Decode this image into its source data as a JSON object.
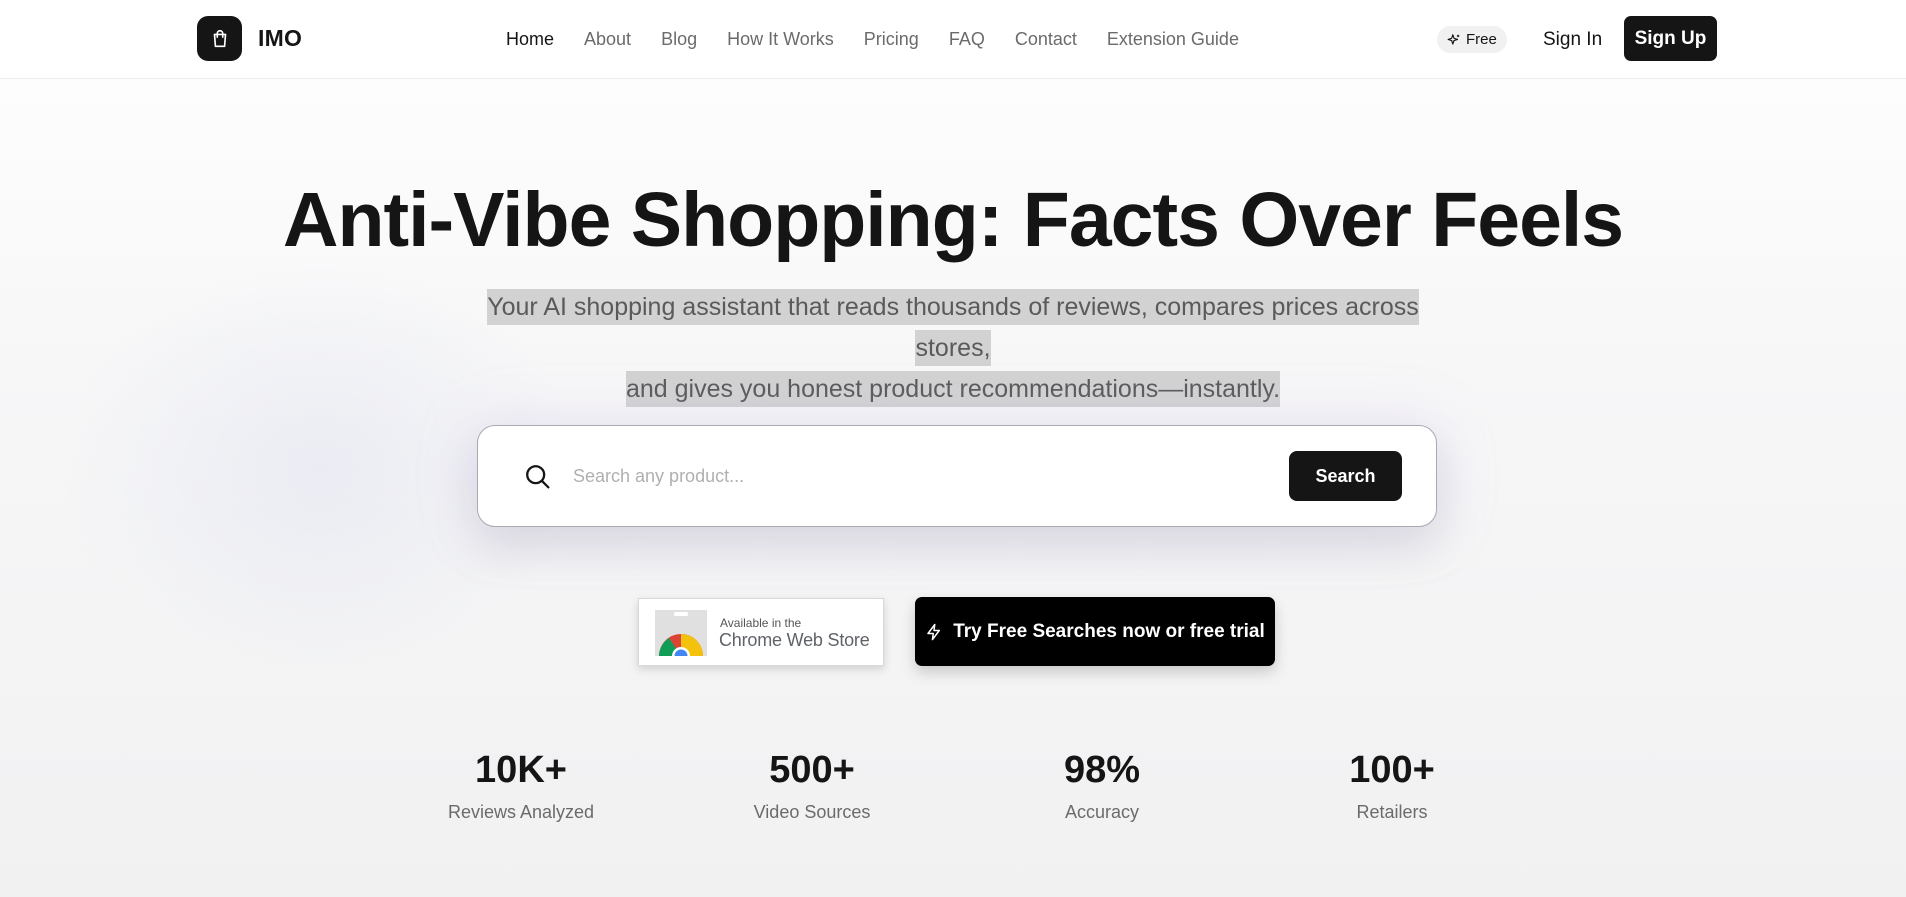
{
  "brand": {
    "name": "IMO",
    "logo_icon": "shopping-bag-icon"
  },
  "nav": {
    "items": [
      {
        "label": "Home",
        "active": true
      },
      {
        "label": "About",
        "active": false
      },
      {
        "label": "Blog",
        "active": false
      },
      {
        "label": "How It Works",
        "active": false
      },
      {
        "label": "Pricing",
        "active": false
      },
      {
        "label": "FAQ",
        "active": false
      },
      {
        "label": "Contact",
        "active": false
      },
      {
        "label": "Extension Guide",
        "active": false
      }
    ]
  },
  "header": {
    "free_badge": "Free",
    "free_badge_icon": "sparkles-icon",
    "sign_in": "Sign In",
    "sign_up": "Sign Up"
  },
  "hero": {
    "title": "Anti-Vibe Shopping: Facts Over Feels",
    "subtitle_line1": "Your AI shopping assistant that reads thousands of reviews, compares prices across stores,",
    "subtitle_line2": "and gives you honest product recommendations—instantly."
  },
  "search": {
    "placeholder": "Search any product...",
    "value": "",
    "button_label": "Search",
    "icon": "search-icon"
  },
  "cta": {
    "chrome_small": "Available in the",
    "chrome_big": "Chrome Web Store",
    "try_label": "Try Free Searches now or free trial",
    "try_icon": "lightning-icon"
  },
  "stats": [
    {
      "value": "10K+",
      "label": "Reviews Analyzed"
    },
    {
      "value": "500+",
      "label": "Video Sources"
    },
    {
      "value": "98%",
      "label": "Accuracy"
    },
    {
      "value": "100+",
      "label": "Retailers"
    }
  ],
  "colors": {
    "primary": "#151515",
    "muted_text": "#6b6b6b",
    "highlight": "#d2d2d2",
    "background": "#f5f5f5"
  }
}
